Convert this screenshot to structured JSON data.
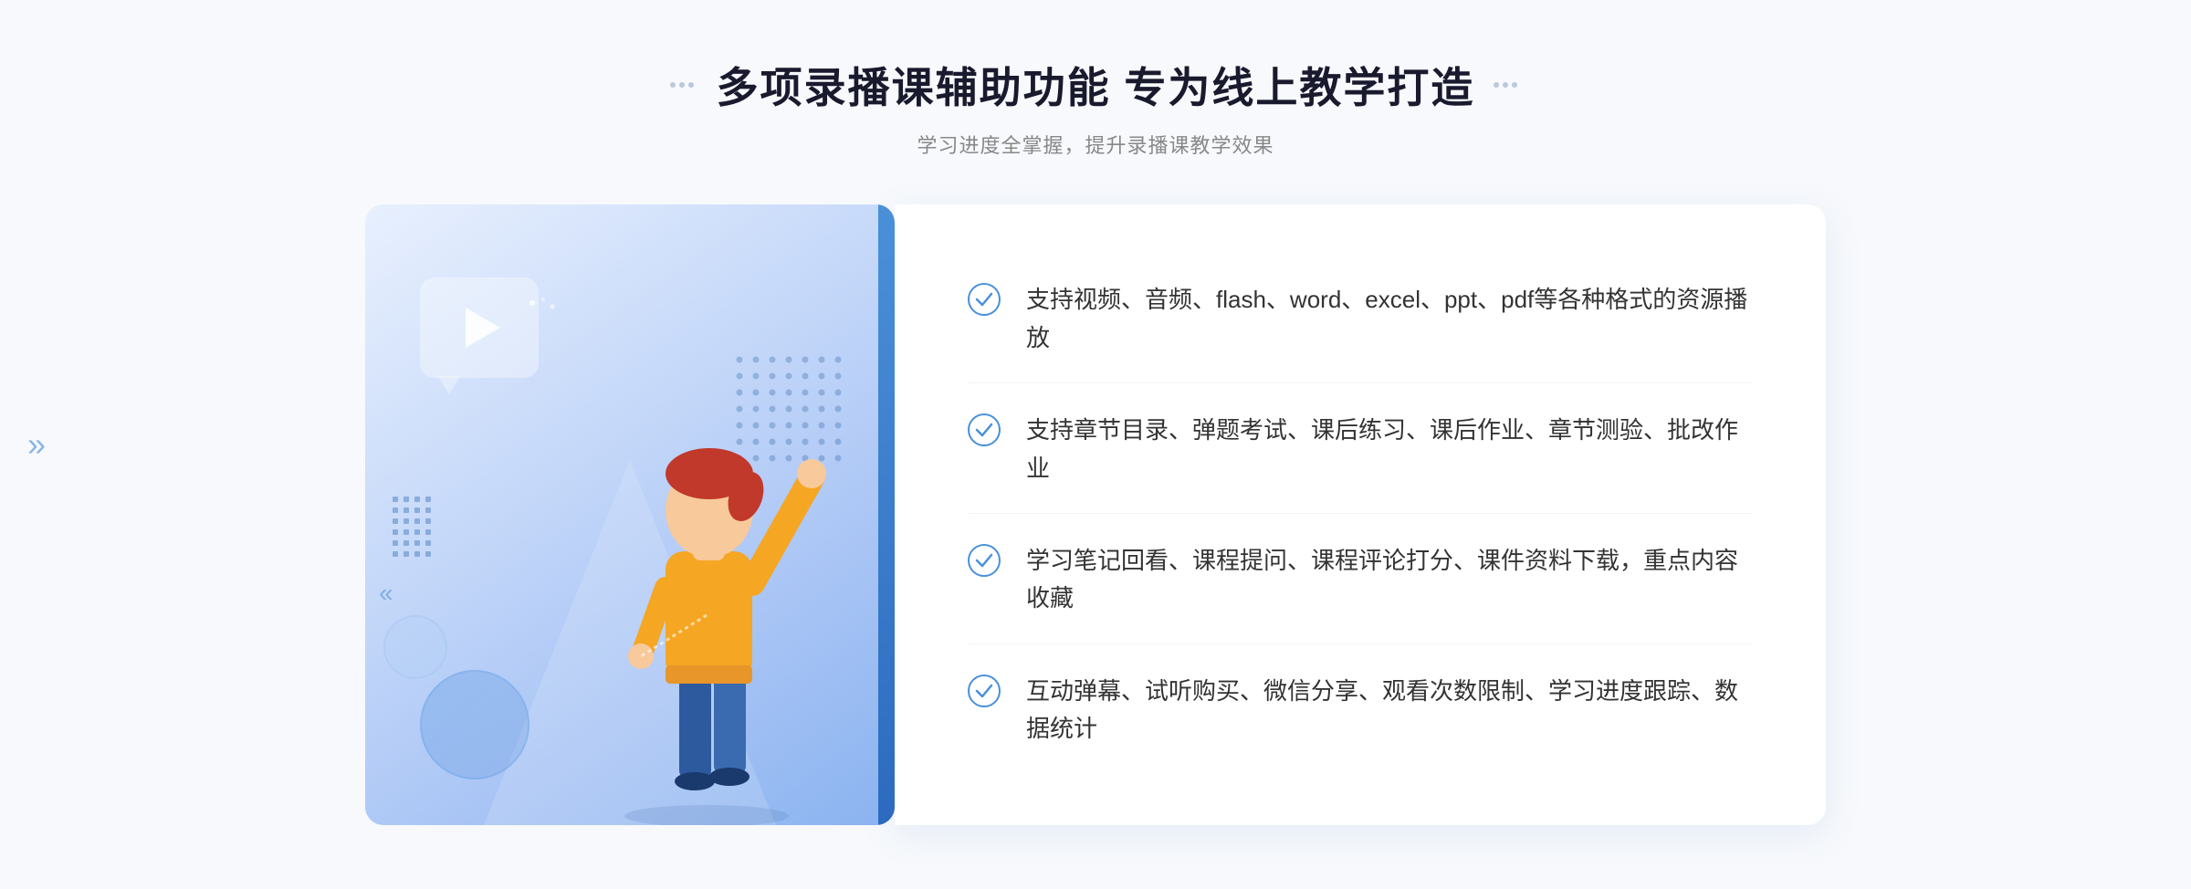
{
  "header": {
    "title": "多项录播课辅助功能 专为线上教学打造",
    "subtitle": "学习进度全掌握，提升录播课教学效果"
  },
  "features": [
    {
      "id": "feature-1",
      "text": "支持视频、音频、flash、word、excel、ppt、pdf等各种格式的资源播放"
    },
    {
      "id": "feature-2",
      "text": "支持章节目录、弹题考试、课后练习、课后作业、章节测验、批改作业"
    },
    {
      "id": "feature-3",
      "text": "学习笔记回看、课程提问、课程评论打分、课件资料下载，重点内容收藏"
    },
    {
      "id": "feature-4",
      "text": "互动弹幕、试听购买、微信分享、观看次数限制、学习进度跟踪、数据统计"
    }
  ],
  "decorations": {
    "left_arrows": "»",
    "check_color": "#4a90d9",
    "accent_color": "#2d6abf"
  }
}
